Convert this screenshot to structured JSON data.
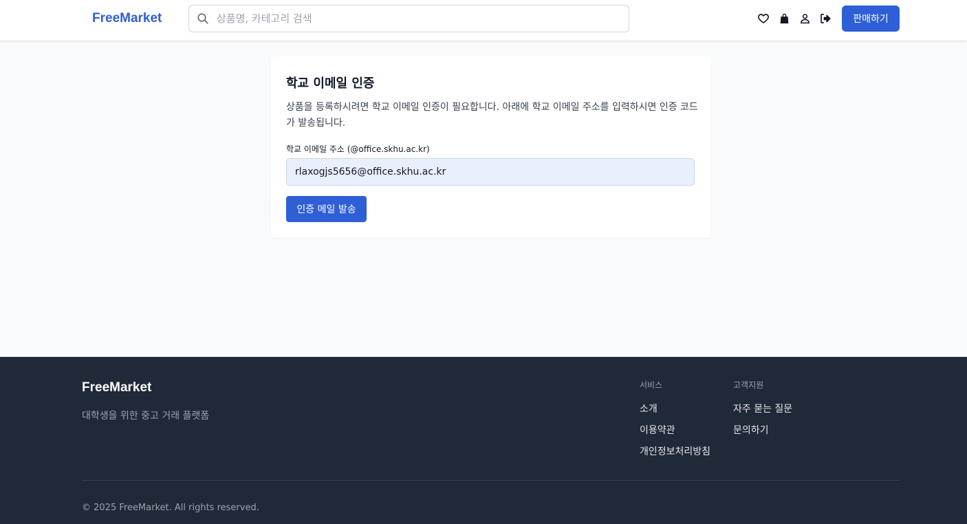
{
  "header": {
    "logo": "FreeMarket",
    "search_placeholder": "상품명, 카테고리 검색",
    "icons": [
      "heart-icon",
      "shopping-bag-icon",
      "user-icon",
      "logout-icon"
    ],
    "sell_button": "판매하기"
  },
  "verify": {
    "title": "학교 이메일 인증",
    "description": "상품을 등록하시려면 학교 이메일 인증이 필요합니다. 아래에 학교 이메일 주소를 입력하시면 인증 코드가 발송됩니다.",
    "email_label": "학교 이메일 주소 (@office.skhu.ac.kr)",
    "email_value": "rlaxogjs5656@office.skhu.ac.kr",
    "send_button": "인증 메일 발송"
  },
  "footer": {
    "brand": "FreeMarket",
    "tagline": "대학생을 위한 중고 거래 플랫폼",
    "service_heading": "서비스",
    "service_links": [
      "소개",
      "이용약관",
      "개인정보처리방침"
    ],
    "support_heading": "고객지원",
    "support_links": [
      "자주 묻는 질문",
      "문의하기"
    ],
    "copyright": "© 2025 FreeMarket. All rights reserved."
  },
  "colors": {
    "accent": "#2f5fd6",
    "footer_bg": "#1f2937",
    "page_bg": "#f9fafb",
    "input_bg": "#e8f0fe"
  }
}
